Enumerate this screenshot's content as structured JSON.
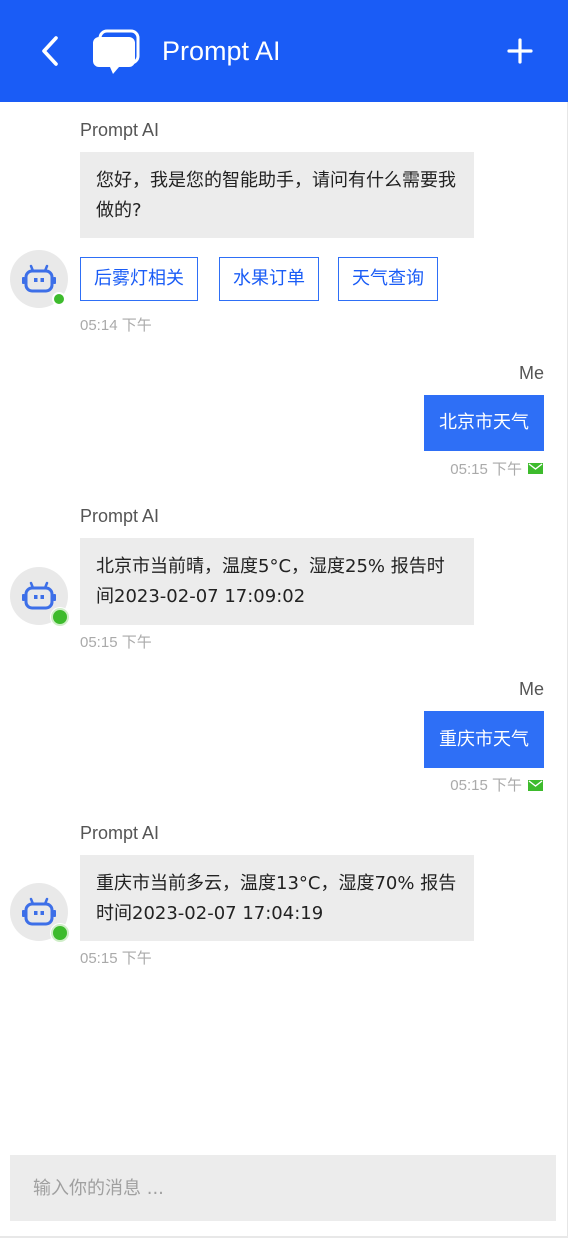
{
  "header": {
    "title": "Prompt AI",
    "back_icon": "chevron-left-icon",
    "logo_icon": "chat-bubbles-icon",
    "add_icon": "plus-icon"
  },
  "colors": {
    "header_bg": "#1a5cf6",
    "user_bubble": "#2e6ff6",
    "ai_bubble": "#ececec",
    "online": "#3dbb2c",
    "sent_icon": "#3dbb2c"
  },
  "messages": [
    {
      "sender": "Prompt AI",
      "text": "您好，我是您的智能助手，请问有什么需要我做的?",
      "quick_replies": [
        "后雾灯相关",
        "水果订单",
        "天气查询"
      ],
      "time": "05:14 下午"
    },
    {
      "sender": "Me",
      "text": "北京市天气",
      "time": "05:15 下午",
      "status_icon": "mail-sent-icon"
    },
    {
      "sender": "Prompt AI",
      "text": "北京市当前晴，温度5°C，湿度25% 报告时间2023-02-07 17:09:02",
      "time": "05:15 下午"
    },
    {
      "sender": "Me",
      "text": "重庆市天气",
      "time": "05:15 下午",
      "status_icon": "mail-sent-icon"
    },
    {
      "sender": "Prompt AI",
      "text": "重庆市当前多云，温度13°C，湿度70% 报告时间2023-02-07 17:04:19",
      "time": "05:15 下午"
    }
  ],
  "composer": {
    "placeholder": "输入你的消息 ...",
    "value": ""
  }
}
